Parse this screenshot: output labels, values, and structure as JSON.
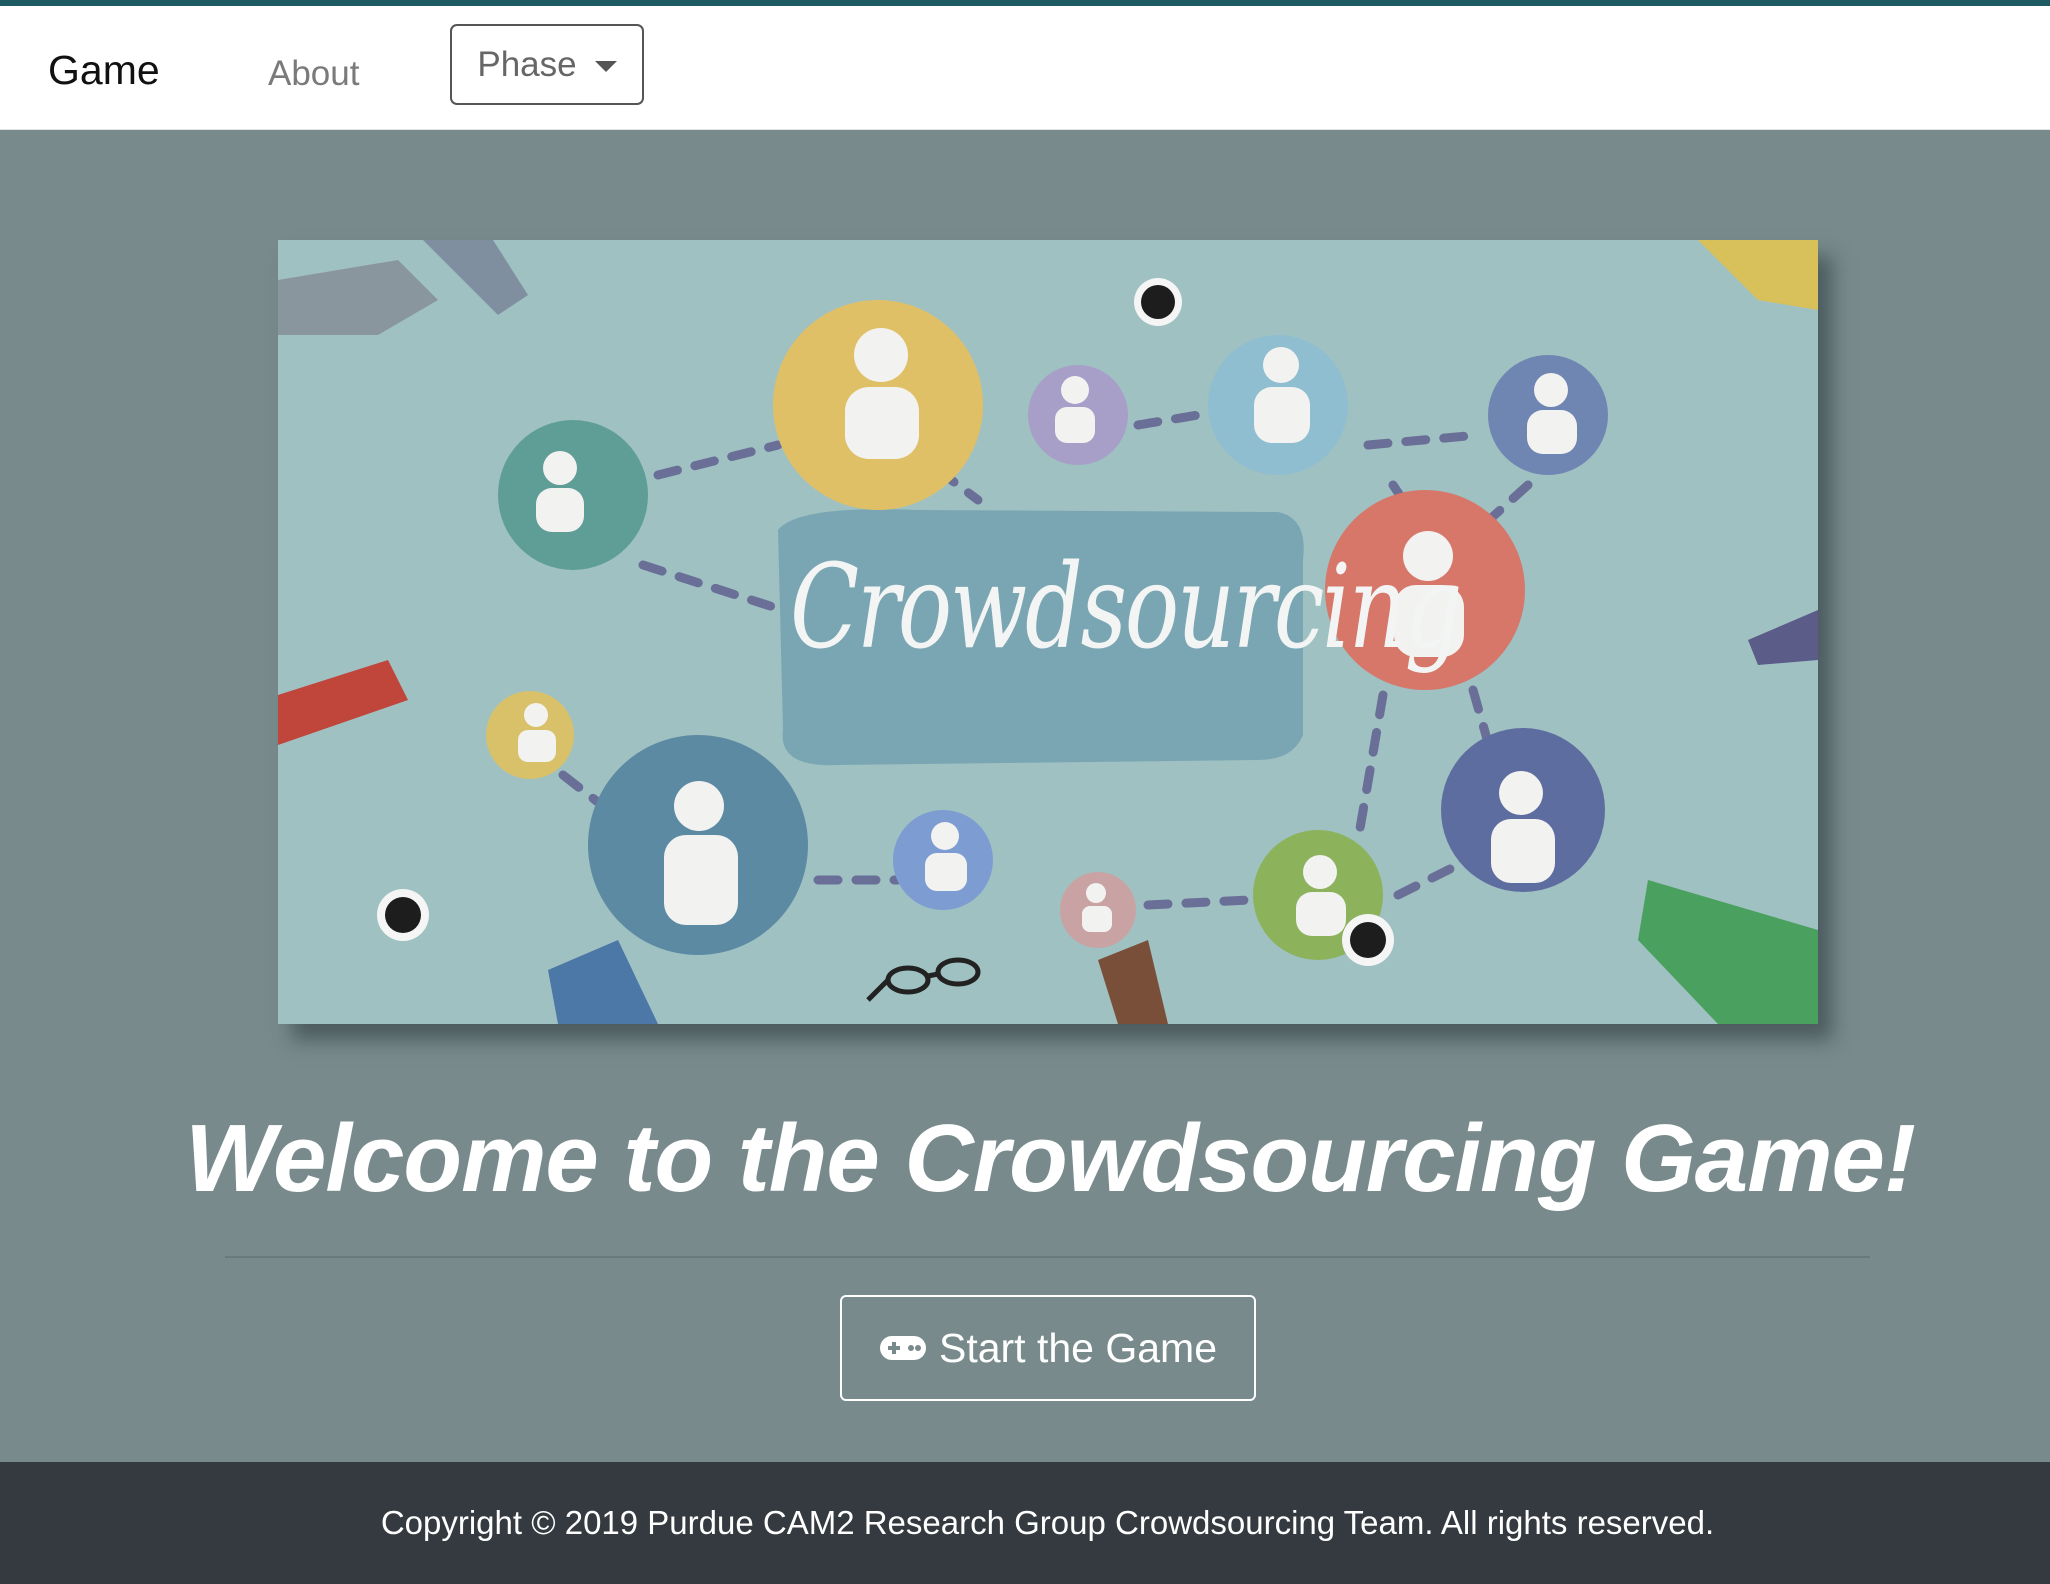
{
  "navbar": {
    "brand": "Game",
    "about": "About",
    "phase_dropdown": "Phase"
  },
  "hero": {
    "image_word": "Crowdsourcing"
  },
  "main": {
    "welcome_title": "Welcome to the Crowdsourcing Game!",
    "start_button": "Start the Game"
  },
  "footer": {
    "copyright": "Copyright © 2019 Purdue CAM2 Research Group Crowdsourcing Team. All rights reserved."
  },
  "colors": {
    "background": "#788a8c",
    "navbar": "#ffffff",
    "footer": "#343a3f",
    "accent_line": "#1e5a62"
  }
}
